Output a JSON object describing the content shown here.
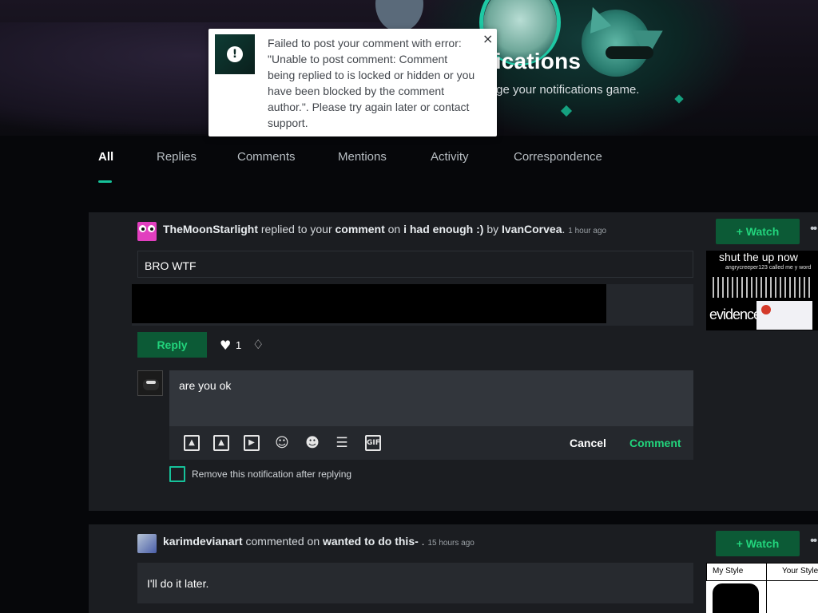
{
  "header": {
    "title": "Notifications",
    "subtitle": "charge your notifications game."
  },
  "toast": {
    "icon": "exclamation-icon",
    "message": "Failed to post your comment with error: \"Unable to post comment: Comment being replied to is locked or hidden or you have been blocked by the comment author.\". Please try again later or contact support.",
    "close": "×"
  },
  "tabs": [
    {
      "label": "All",
      "active": true
    },
    {
      "label": "Replies"
    },
    {
      "label": "Comments"
    },
    {
      "label": "Mentions"
    },
    {
      "label": "Activity"
    },
    {
      "label": "Correspondence"
    }
  ],
  "notifications": [
    {
      "user": "TheMoonStarlight",
      "action1": "replied to your",
      "target_type": "comment",
      "action2": "on",
      "deviation": "i had enough :)",
      "by": "by",
      "author": "IvanCorvea",
      "dot": ".",
      "time": "1 hour ago",
      "comment": "BRO WTF",
      "watch_label": "+ Watch",
      "more": "••",
      "thumb": {
        "line1": "shut the up now",
        "line2": "angrycreeper123 called me y word",
        "line3": "evidence:"
      },
      "reply_label": "Reply",
      "likes": "1",
      "heart_icon": "♥",
      "badge_icon": "♢",
      "reply_editor": {
        "value": "are you ok",
        "cancel_label": "Cancel",
        "submit_label": "Comment",
        "toolbar_icons": [
          "image-icon",
          "gallery-icon",
          "video-icon",
          "emoji-icon",
          "emoticon-icon",
          "divider-icon",
          "gif-icon"
        ],
        "gif_text": "GIF"
      },
      "remove_after_reply_label": "Remove this notification after replying",
      "remove_after_reply_checked": false
    },
    {
      "user": "karimdevianart",
      "action1": "commented on",
      "deviation": "wanted to do this-",
      "dot": ".",
      "time": "15 hours ago",
      "comment": "I'll do it later.",
      "watch_label": "+ Watch",
      "more": "••",
      "thumb": {
        "cell1": "My Style",
        "cell2": "Your Style"
      }
    }
  ],
  "colors": {
    "accent": "#16c29a",
    "button_bg": "#0c5a36",
    "button_text": "#22d47c",
    "card_bg": "#1b1d21",
    "page_bg": "#06070a"
  }
}
